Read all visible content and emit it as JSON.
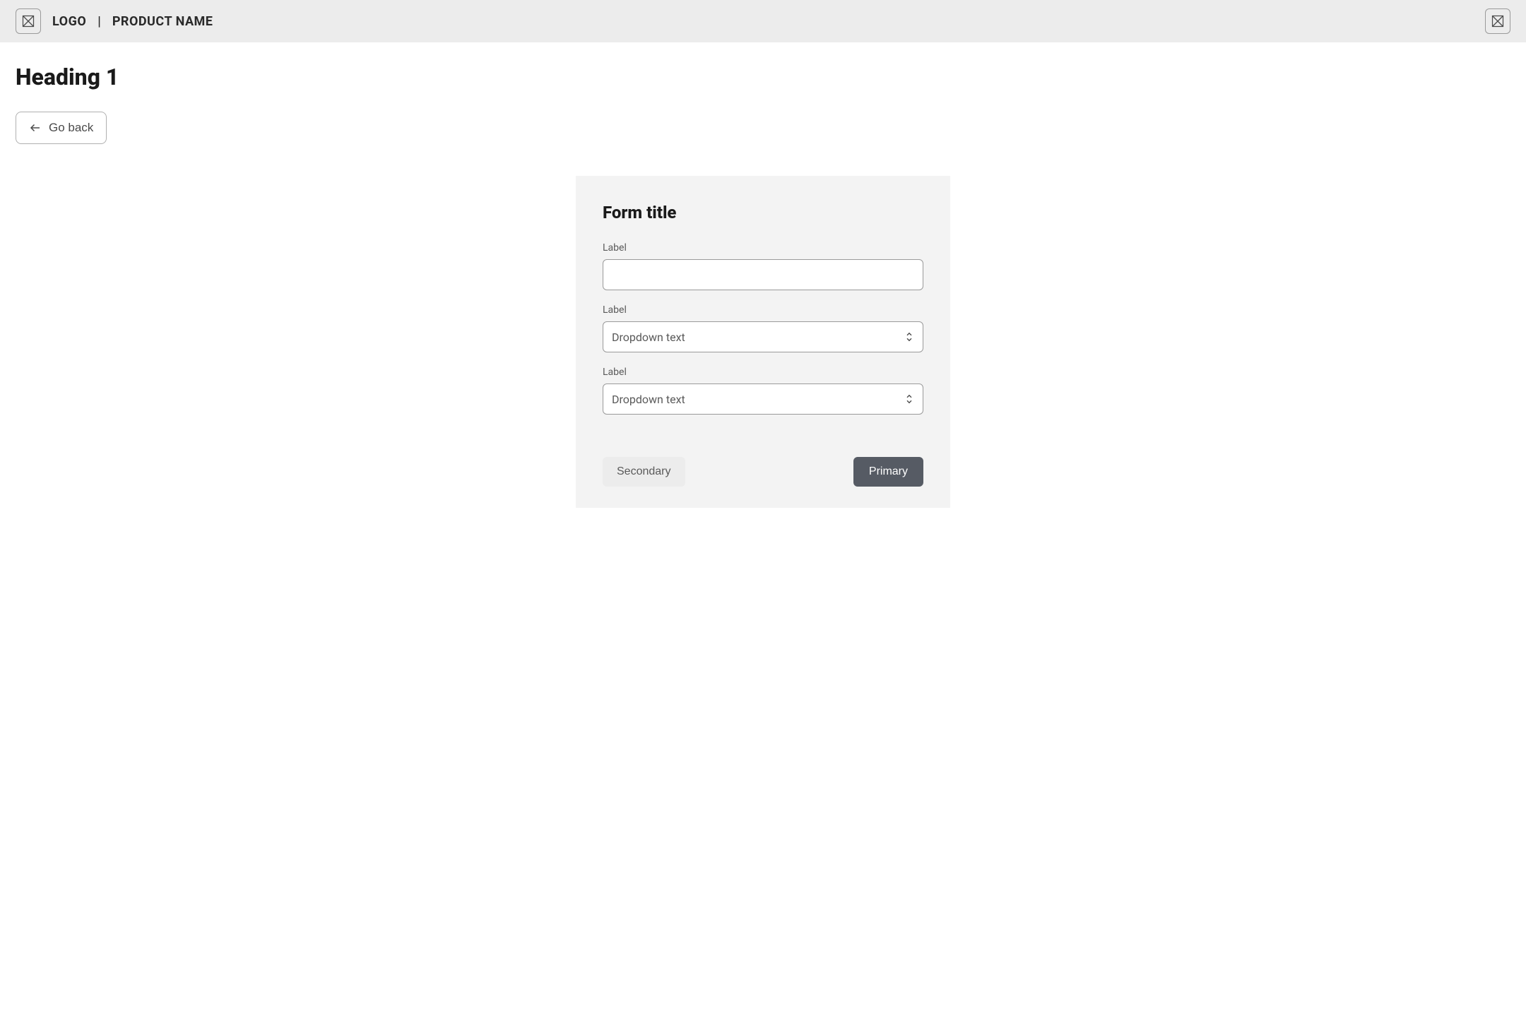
{
  "header": {
    "logo_text": "LOGO",
    "divider": "|",
    "product_name": "PRODUCT NAME"
  },
  "page": {
    "heading": "Heading 1",
    "back_button": "Go back"
  },
  "form": {
    "title": "Form title",
    "fields": [
      {
        "label": "Label",
        "type": "text",
        "value": ""
      },
      {
        "label": "Label",
        "type": "dropdown",
        "value": "Dropdown text"
      },
      {
        "label": "Label",
        "type": "dropdown",
        "value": "Dropdown text"
      }
    ],
    "actions": {
      "secondary": "Secondary",
      "primary": "Primary"
    }
  }
}
